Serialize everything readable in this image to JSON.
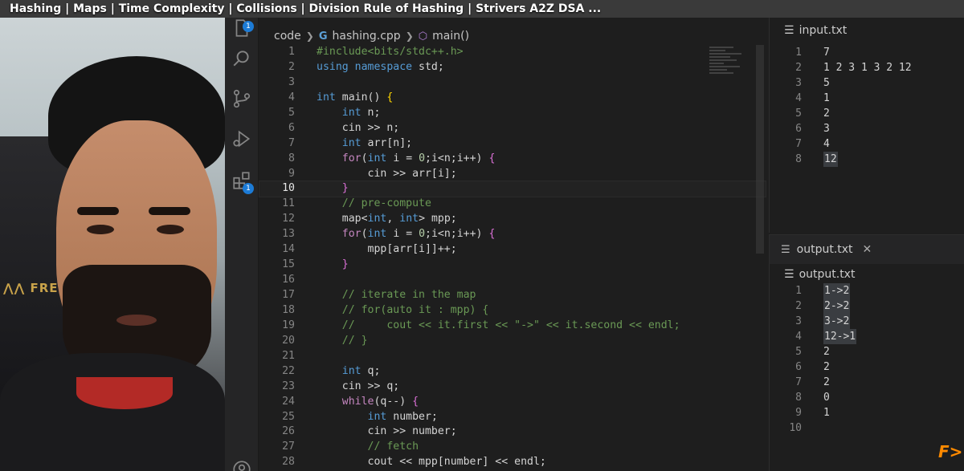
{
  "video": {
    "title": "Hashing | Maps | Time Complexity | Collisions | Division Rule of Hashing | Strivers A2Z DSA ..."
  },
  "activity_bar": {
    "explorer_badge": "1",
    "extensions_badge": "1"
  },
  "breadcrumb": {
    "folder": "code",
    "file": "hashing.cpp",
    "symbol": "main()"
  },
  "code_lines": [
    {
      "n": "1",
      "html": "<span class=\"cm\">#include&lt;bits/stdc++.h&gt;</span>"
    },
    {
      "n": "2",
      "html": "<span class=\"kw\">using namespace</span> std;"
    },
    {
      "n": "3",
      "html": ""
    },
    {
      "n": "4",
      "html": "<span class=\"ty\">int</span> main() <span class=\"br1\">{</span>"
    },
    {
      "n": "5",
      "html": "    <span class=\"ty\">int</span> n;"
    },
    {
      "n": "6",
      "html": "    cin &gt;&gt; n;"
    },
    {
      "n": "7",
      "html": "    <span class=\"ty\">int</span> arr[n];"
    },
    {
      "n": "8",
      "html": "    <span class=\"ctl\">for</span>(<span class=\"ty\">int</span> i = <span class=\"num\">0</span>;i&lt;n;i++) <span class=\"br2\">{</span>"
    },
    {
      "n": "9",
      "html": "        cin &gt;&gt; arr[i];"
    },
    {
      "n": "10",
      "html": "    <span class=\"br2\">}</span>"
    },
    {
      "n": "11",
      "html": "    <span class=\"cm\">// pre-compute</span>"
    },
    {
      "n": "12",
      "html": "    map&lt;<span class=\"ty\">int</span>, <span class=\"ty\">int</span>&gt; mpp;"
    },
    {
      "n": "13",
      "html": "    <span class=\"ctl\">for</span>(<span class=\"ty\">int</span> i = <span class=\"num\">0</span>;i&lt;n;i++) <span class=\"br2\">{</span>"
    },
    {
      "n": "14",
      "html": "        mpp[arr[i]]++;"
    },
    {
      "n": "15",
      "html": "    <span class=\"br2\">}</span>"
    },
    {
      "n": "16",
      "html": ""
    },
    {
      "n": "17",
      "html": "    <span class=\"cm\">// iterate in the map</span>"
    },
    {
      "n": "18",
      "html": "    <span class=\"cm\">// for(auto it : mpp) {</span>"
    },
    {
      "n": "19",
      "html": "    <span class=\"cm\">//     cout &lt;&lt; it.first &lt;&lt; \"-&gt;\" &lt;&lt; it.second &lt;&lt; endl;</span>"
    },
    {
      "n": "20",
      "html": "    <span class=\"cm\">// }</span>"
    },
    {
      "n": "21",
      "html": ""
    },
    {
      "n": "22",
      "html": "    <span class=\"ty\">int</span> q;"
    },
    {
      "n": "23",
      "html": "    cin &gt;&gt; q;"
    },
    {
      "n": "24",
      "html": "    <span class=\"ctl\">while</span>(q--) <span class=\"br2\">{</span>"
    },
    {
      "n": "25",
      "html": "        <span class=\"ty\">int</span> number;"
    },
    {
      "n": "26",
      "html": "        cin &gt;&gt; number;"
    },
    {
      "n": "27",
      "html": "        <span class=\"cm\">// fetch</span>"
    },
    {
      "n": "28",
      "html": "        cout &lt;&lt; mpp[number] &lt;&lt; endl;"
    }
  ],
  "active_line": "10",
  "input_pane": {
    "tab_label": "input.txt",
    "lines": [
      {
        "n": "1",
        "v": "7"
      },
      {
        "n": "2",
        "v": "1 2 3 1 3 2 12"
      },
      {
        "n": "3",
        "v": "5"
      },
      {
        "n": "4",
        "v": "1"
      },
      {
        "n": "5",
        "v": "2"
      },
      {
        "n": "6",
        "v": "3"
      },
      {
        "n": "7",
        "v": "4"
      },
      {
        "n": "8",
        "v": "12"
      }
    ]
  },
  "output_pane": {
    "tab_label": "output.txt",
    "close_glyph": "✕",
    "header": "output.txt",
    "lines": [
      {
        "n": "1",
        "v": "1->2"
      },
      {
        "n": "2",
        "v": "2->2"
      },
      {
        "n": "3",
        "v": "3->2"
      },
      {
        "n": "4",
        "v": "12->1"
      },
      {
        "n": "5",
        "v": "2"
      },
      {
        "n": "6",
        "v": "2"
      },
      {
        "n": "7",
        "v": "2"
      },
      {
        "n": "8",
        "v": "0"
      },
      {
        "n": "9",
        "v": "1"
      },
      {
        "n": "10",
        "v": ""
      }
    ]
  },
  "watermark": {
    "letter": "F",
    "accent": ">"
  }
}
